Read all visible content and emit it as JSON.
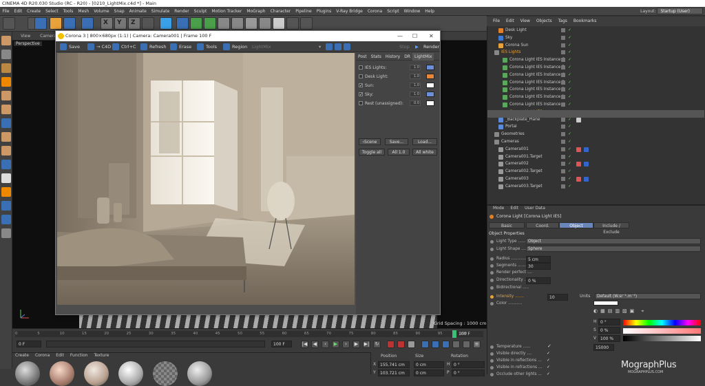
{
  "window": {
    "title": "CINEMA 4D R20.030 Studio (RC - R20) - [0210_LightMix.c4d *] - Main"
  },
  "menu": {
    "items": [
      "File",
      "Edit",
      "Create",
      "Select",
      "Tools",
      "Mesh",
      "Volume",
      "Snap",
      "Animate",
      "Simulate",
      "Render",
      "Sculpt",
      "Motion Tracker",
      "MoGraph",
      "Character",
      "Pipeline",
      "Plugins",
      "V-Ray Bridge",
      "Corona",
      "Script",
      "Window",
      "Help"
    ],
    "layout_label": "Layout:",
    "layout_value": "Startup (User)"
  },
  "viewport": {
    "menu": [
      "View",
      "Cameras"
    ],
    "label": "Perspective",
    "grid_spacing": "Grid Spacing : 1000 cm"
  },
  "vfb": {
    "title": "Corona 3 | 800×680px (1:1) | Camera: Camera001 | Frame 100 F",
    "toolbar": {
      "save": "Save",
      "c4d": "→ C4D",
      "ctrlc": "Ctrl+C",
      "refresh": "Refresh",
      "erase": "Erase",
      "tools": "Tools",
      "region": "Region",
      "lightmix": "LightMix",
      "stop": "Stop",
      "render": "Render"
    },
    "side_tabs": [
      "Post",
      "Stats",
      "History",
      "DR",
      "LightMix"
    ],
    "lightmix": [
      {
        "name": "IES Lights:",
        "checked": false,
        "value": "1.0",
        "color": "#6b8fd8"
      },
      {
        "name": "Desk Light:",
        "checked": false,
        "value": "1.0",
        "color": "#e8873a"
      },
      {
        "name": "Sun:",
        "checked": true,
        "value": "1.0",
        "color": "#ffffff"
      },
      {
        "name": "Sky:",
        "checked": true,
        "value": "1.0",
        "color": "#6b8fd8"
      },
      {
        "name": "Rest (unassigned):",
        "checked": false,
        "value": "0.0",
        "color": "#ffffff"
      }
    ],
    "buttons": {
      "scene": "›Scene",
      "save": "Save...",
      "load": "Load...",
      "toggle_all": "Toggle all",
      "all10": "All 1.0",
      "all_white": "All white"
    }
  },
  "timeline": {
    "ticks": [
      "0",
      "5",
      "10",
      "15",
      "20",
      "25",
      "30",
      "35",
      "40",
      "45",
      "50",
      "55",
      "60",
      "65",
      "70",
      "75",
      "80",
      "85",
      "90",
      "95",
      "100"
    ],
    "current_frame": "100 F",
    "start_field": "0 F",
    "end_field": "100 F",
    "end_field2": "100 F"
  },
  "material_manager": {
    "menu": [
      "Create",
      "Corona",
      "Edit",
      "Function",
      "Texture"
    ]
  },
  "coordinates": {
    "headers": [
      "Position",
      "Size",
      "Rotation"
    ],
    "rows": [
      {
        "axis": "X",
        "pos": "155.741 cm",
        "size": "0 cm",
        "rot_axis": "H",
        "rot": "0 °"
      },
      {
        "axis": "Y",
        "pos": "103.721 cm",
        "size": "0 cm",
        "rot_axis": "P",
        "rot": "0 °"
      }
    ]
  },
  "object_manager": {
    "menu": [
      "File",
      "Edit",
      "View",
      "Objects",
      "Tags",
      "Bookmarks"
    ],
    "objects": [
      {
        "name": "Desk Light",
        "indent": 1,
        "icon": "#e0802a",
        "color": "#ccc"
      },
      {
        "name": "Sky",
        "indent": 1,
        "icon": "#3d7ad8",
        "color": "#ccc"
      },
      {
        "name": "Corona Sun",
        "indent": 1,
        "icon": "#e8a23a",
        "color": "#ccc"
      },
      {
        "name": "IES Lights",
        "indent": 0,
        "icon": "#888",
        "color": "#e8a23a"
      },
      {
        "name": "Corona Light IES Instance.6",
        "indent": 2,
        "icon": "#5aa85a",
        "color": "#ccc"
      },
      {
        "name": "Corona Light IES Instance.5",
        "indent": 2,
        "icon": "#5aa85a",
        "color": "#ccc"
      },
      {
        "name": "Corona Light IES Instance.4",
        "indent": 2,
        "icon": "#5aa85a",
        "color": "#ccc"
      },
      {
        "name": "Corona Light IES Instance.3",
        "indent": 2,
        "icon": "#5aa85a",
        "color": "#ccc"
      },
      {
        "name": "Corona Light IES Instance.2",
        "indent": 2,
        "icon": "#5aa85a",
        "color": "#ccc"
      },
      {
        "name": "Corona Light IES Instance.1",
        "indent": 2,
        "icon": "#5aa85a",
        "color": "#ccc"
      },
      {
        "name": "Corona Light IES Instance",
        "indent": 2,
        "icon": "#5aa85a",
        "color": "#ccc"
      },
      {
        "name": "Corona Light IES",
        "indent": 2,
        "icon": "#e0802a",
        "color": "#e8a23a"
      },
      {
        "name": "_Backplate_Plane",
        "indent": 1,
        "icon": "#5a8ad8",
        "color": "#ccc"
      },
      {
        "name": "Portal",
        "indent": 1,
        "icon": "#5a8ad8",
        "color": "#ccc"
      },
      {
        "name": "Geometries",
        "indent": 0,
        "icon": "#888",
        "color": "#ccc"
      },
      {
        "name": "Cameras",
        "indent": 0,
        "icon": "#888",
        "color": "#ccc"
      },
      {
        "name": "Camera001",
        "indent": 1,
        "icon": "#999",
        "color": "#ccc"
      },
      {
        "name": "Camera001.Target",
        "indent": 1,
        "icon": "#999",
        "color": "#ccc"
      },
      {
        "name": "Camera002",
        "indent": 1,
        "icon": "#999",
        "color": "#ccc"
      },
      {
        "name": "Camera002.Target",
        "indent": 1,
        "icon": "#999",
        "color": "#ccc"
      },
      {
        "name": "Camera003",
        "indent": 1,
        "icon": "#999",
        "color": "#ccc"
      },
      {
        "name": "Camera003.Target",
        "indent": 1,
        "icon": "#999",
        "color": "#ccc"
      }
    ]
  },
  "attributes": {
    "menu": [
      "Mode",
      "Edit",
      "User Data"
    ],
    "title": "Corona Light [Corona Light IES]",
    "tabs": [
      "Basic",
      "Coord.",
      "Object",
      "Include / Exclude"
    ],
    "active_tab": "Object",
    "section": "Object Properties",
    "rows": [
      {
        "label": "Light Type ........",
        "value": "Object"
      },
      {
        "label": "Light Shape .......",
        "value": "Sphere"
      },
      {
        "label": "Radius ............",
        "value": "5 cm"
      },
      {
        "label": "Segments ..........",
        "value": "30"
      },
      {
        "label": "Render perfect ....",
        "value": ""
      },
      {
        "label": "Directionality ....",
        "value": "0 %"
      },
      {
        "label": "Bidirectional .....",
        "value": ""
      }
    ],
    "intensity_label": "Intensity .......",
    "intensity_value": "10",
    "units_label": "Units",
    "units_value": "Default (W.sr⁻¹.m⁻²)",
    "color_label": "Color ...........",
    "h_label": "H",
    "h_value": "0 °",
    "s_label": "S",
    "s_value": "0 %",
    "v_label": "V",
    "v_value": "100 %",
    "temperature_label": "Temperature ......",
    "temperature_value": "15000",
    "visible_rows": [
      "Visible directly ....",
      "Visible in reflections ...",
      "Visible in refractions ...",
      "Occlude other lights ..."
    ]
  },
  "watermark": {
    "brand": "MographPlus",
    "url": "MOGRAPHPLUS.COM"
  }
}
